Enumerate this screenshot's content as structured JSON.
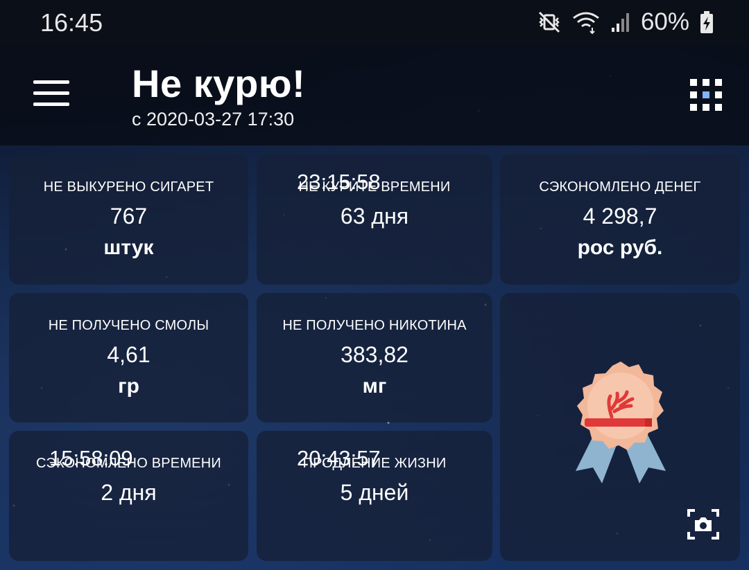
{
  "status_bar": {
    "time": "16:45",
    "battery_percent": "60%",
    "icons": [
      "vibrate-icon",
      "wifi-icon",
      "signal-icon",
      "battery-charging-icon"
    ]
  },
  "app_bar": {
    "title": "Не курю!",
    "subtitle": "с 2020-03-27 17:30",
    "menu_icon": "hamburger-menu-icon",
    "grid_icon": "grid-view-icon"
  },
  "cards": {
    "cigarettes": {
      "label": "НЕ ВЫКУРЕНО СИГАРЕТ",
      "value": "767",
      "unit": "штук"
    },
    "time_not_smoking": {
      "label": "НЕ КУРИТЕ ВРЕМЕНИ",
      "value": "63 дня",
      "unit": "23:15:58"
    },
    "money_saved": {
      "label": "СЭКОНОМЛЕНО ДЕНЕГ",
      "value": "4 298,7",
      "unit": "рос руб."
    },
    "tar": {
      "label": "НЕ ПОЛУЧЕНО СМОЛЫ",
      "value": "4,61",
      "unit": "гр"
    },
    "nicotine": {
      "label": "НЕ ПОЛУЧЕНО НИКОТИНА",
      "value": "383,82",
      "unit": "мг"
    },
    "time_saved": {
      "label": "СЭКОНОМЛЕНО ВРЕМЕНИ",
      "value": "2 дня",
      "unit": "15:58:09"
    },
    "life_extension": {
      "label": "ПРОДЛЕНИЕ ЖИЗНИ",
      "value": "5 дней",
      "unit": "20:43:57"
    }
  },
  "achievement": {
    "icon": "medal-icon",
    "camera_icon": "camera-icon"
  },
  "colors": {
    "accent": "#7fb5ff",
    "medal_orange": "#f2b89a",
    "medal_ribbon": "#8fb4cf",
    "cigarette_red": "#e0393a"
  }
}
